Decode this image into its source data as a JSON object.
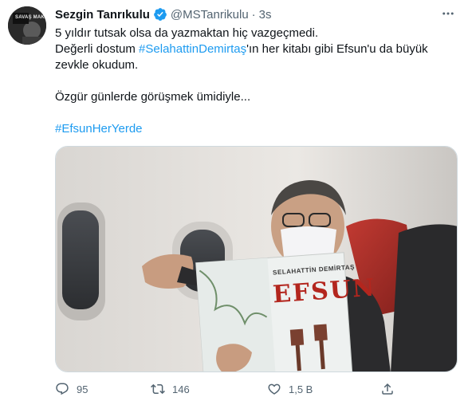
{
  "tweet": {
    "author_name": "Sezgin Tanrıkulu",
    "handle": "@MSTanrikulu",
    "separator": "·",
    "time": "3s",
    "avatar_text": "SAVAŞ MAKİ",
    "text": {
      "line1": "5 yıldır tutsak olsa da yazmaktan hiç vazgeçmedi.",
      "line2_before": "Değerli dostum ",
      "line2_hashtag": "#SelahattinDemirtaş",
      "line2_after": "'ın her kitabı gibi Efsun'u da büyük",
      "line3": "zevkle okudum.",
      "line4": "Özgür günlerde görüşmek ümidiyle...",
      "hashtag2": "#EfsunHerYerde"
    },
    "media": {
      "book_author": "SELAHATTİN DEMİRTAŞ",
      "book_title": "EFSUN"
    }
  },
  "actions": {
    "replies": "95",
    "retweets": "146",
    "likes": "1,5 B"
  },
  "colors": {
    "accent": "#1d9bf0",
    "text": "#0f1419",
    "secondary": "#536471"
  }
}
